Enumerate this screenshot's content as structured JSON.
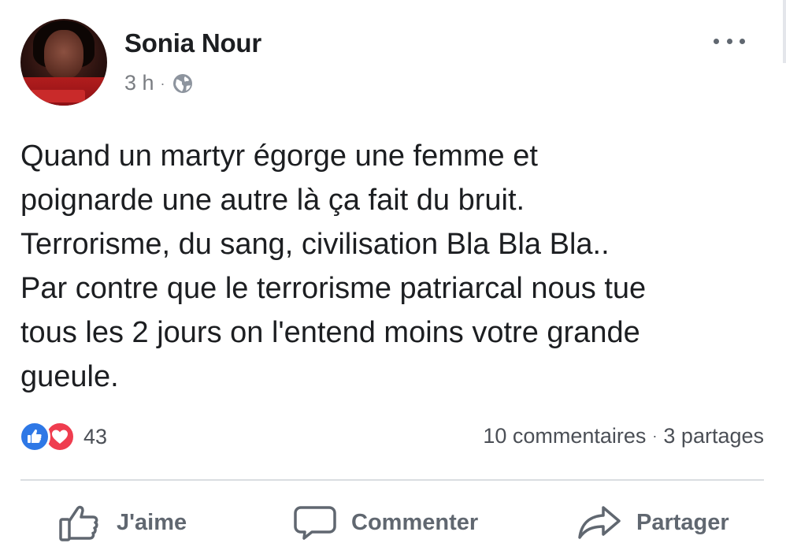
{
  "post": {
    "author": "Sonia Nour",
    "time": "3 h",
    "meta_separator": "·",
    "privacy_icon": "globe-icon",
    "more_icon": "more-options-icon",
    "body_lines": [
      "Quand un martyr égorge une femme et",
      "poignarde une autre là ça fait du bruit.",
      "Terrorisme, du sang, civilisation Bla Bla Bla..",
      "Par contre que le terrorisme patriarcal nous tue",
      "tous les 2 jours on l'entend moins votre grande",
      "gueule."
    ]
  },
  "engagement": {
    "reaction_icons": [
      "like-reaction-icon",
      "love-reaction-icon"
    ],
    "reaction_count": "43",
    "comments": "10 commentaires",
    "separator": "·",
    "shares": "3 partages"
  },
  "actions": {
    "like_label": "J'aime",
    "comment_label": "Commenter",
    "share_label": "Partager"
  },
  "colors": {
    "text_primary": "#1c1e21",
    "text_secondary": "#606770",
    "like_blue": "#2e78e6",
    "love_red": "#ef3d4f",
    "divider": "#dadde1"
  }
}
